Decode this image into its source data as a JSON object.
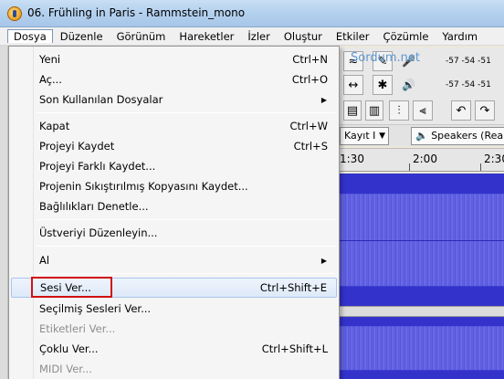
{
  "window": {
    "title": "06. Frühling in Paris - Rammstein_mono"
  },
  "menubar": {
    "items": [
      "Dosya",
      "Düzenle",
      "Görünüm",
      "Hareketler",
      "İzler",
      "Oluştur",
      "Etkiler",
      "Çözümle",
      "Yardım"
    ]
  },
  "watermark": "Sordum.net",
  "meters": {
    "record_scale": "-57 -54 -51",
    "play_scale": "-57 -54 -51"
  },
  "device_toolbar": {
    "input_combo": "Kayıt I",
    "output_combo": "Speakers (Realtek Hi"
  },
  "ruler": {
    "labels": [
      "1:30",
      "2:00",
      "2:30"
    ]
  },
  "file_menu": {
    "items": [
      {
        "label": "Yeni",
        "shortcut": "Ctrl+N"
      },
      {
        "label": "Aç...",
        "shortcut": "Ctrl+O"
      },
      {
        "label": "Son Kullanılan Dosyalar",
        "shortcut": ""
      },
      {
        "label": "Kapat",
        "shortcut": "Ctrl+W"
      },
      {
        "label": "Projeyi Kaydet",
        "shortcut": "Ctrl+S"
      },
      {
        "label": "Projeyi Farklı Kaydet...",
        "shortcut": ""
      },
      {
        "label": "Projenin Sıkıştırılmış Kopyasını Kaydet...",
        "shortcut": ""
      },
      {
        "label": "Bağlılıkları Denetle...",
        "shortcut": ""
      },
      {
        "label": "Üstveriyi Düzenleyin...",
        "shortcut": ""
      },
      {
        "label": "Al",
        "shortcut": ""
      },
      {
        "label": "Sesi Ver...",
        "shortcut": "Ctrl+Shift+E"
      },
      {
        "label": "Seçilmiş Sesleri Ver...",
        "shortcut": ""
      },
      {
        "label": "Etiketleri Ver...",
        "shortcut": ""
      },
      {
        "label": "Çoklu Ver...",
        "shortcut": "Ctrl+Shift+L"
      },
      {
        "label": "MIDI Ver...",
        "shortcut": ""
      }
    ]
  },
  "icons": {
    "app": "audacity-icon",
    "submenu": "submenu-arrow-icon",
    "dropdown": "chevron-down-icon"
  },
  "colors": {
    "highlight_box": "#d01010",
    "waveform": "#3333cc"
  }
}
